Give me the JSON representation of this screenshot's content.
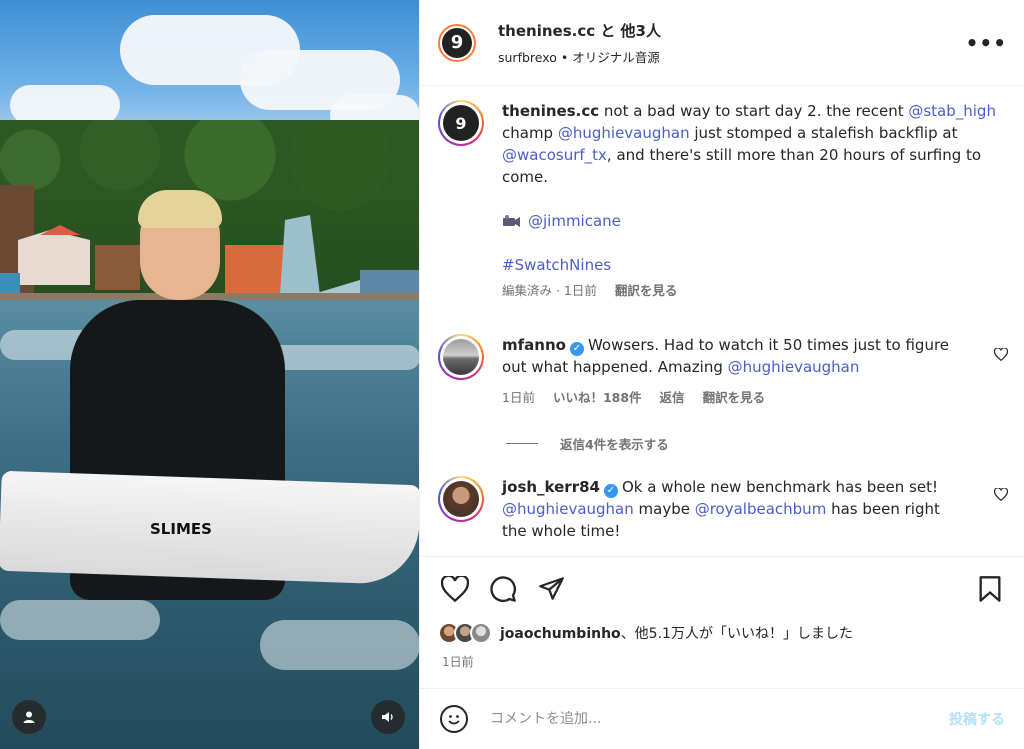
{
  "media": {
    "board_brand": "SLIMES",
    "icons": {
      "user_tag": "person-icon",
      "sound": "speaker-icon"
    }
  },
  "header": {
    "title": "thenines.cc と 他3人",
    "subtitle": "surfbrexo • オリジナル音源",
    "more_icon": "ellipsis-icon",
    "avatar_letter": "9"
  },
  "caption": {
    "username": "thenines.cc",
    "text_parts": {
      "t1": "not a bad way to start day 2. the recent ",
      "m1": "@stab_high",
      "t2": " champ ",
      "m2": "@hughievaughan",
      "t3": " just stomped a stalefish backflip at ",
      "m3": "@wacosurf_tx",
      "t4": ", and there's still more than 20 hours of surfing to come."
    },
    "camera_credit_icon": "video-camera-icon",
    "credit": "@jimmicane",
    "hashtag": "#SwatchNines",
    "meta_edited": "編集済み · 1日前",
    "meta_translate": "翻訳を見る"
  },
  "comments": [
    {
      "username": "mfanno",
      "verified": true,
      "text": "Wowsers. Had to watch it 50 times just to figure out what happened. Amazing ",
      "mention": "@hughievaughan",
      "time": "1日前",
      "likes": "いいね！188件",
      "reply": "返信",
      "translate": "翻訳を見る"
    },
    {
      "username": "josh_kerr84",
      "verified": true,
      "text": "Ok a whole new benchmark has been set! ",
      "mention1": "@hughievaughan",
      "mid": " maybe ",
      "mention2": "@royalbeachbum",
      "end": " has been right the whole time!"
    }
  ],
  "replies_toggle": "返信4件を表示する",
  "actions": {
    "like": "heart-icon",
    "comment": "comment-bubble-icon",
    "share": "paper-plane-icon",
    "save": "bookmark-icon"
  },
  "likes": {
    "user": "joaochumbinho",
    "rest": "、他5.1万人が「いいね！」しました"
  },
  "date": "1日前",
  "comment_box": {
    "emoji_icon": "smiley-icon",
    "placeholder": "コメントを追加...",
    "post_label": "投稿する"
  },
  "colors": {
    "mention": "#4b5ec7",
    "verified": "#3897f0",
    "post_disabled": "#b2dffc",
    "muted": "#737373"
  }
}
